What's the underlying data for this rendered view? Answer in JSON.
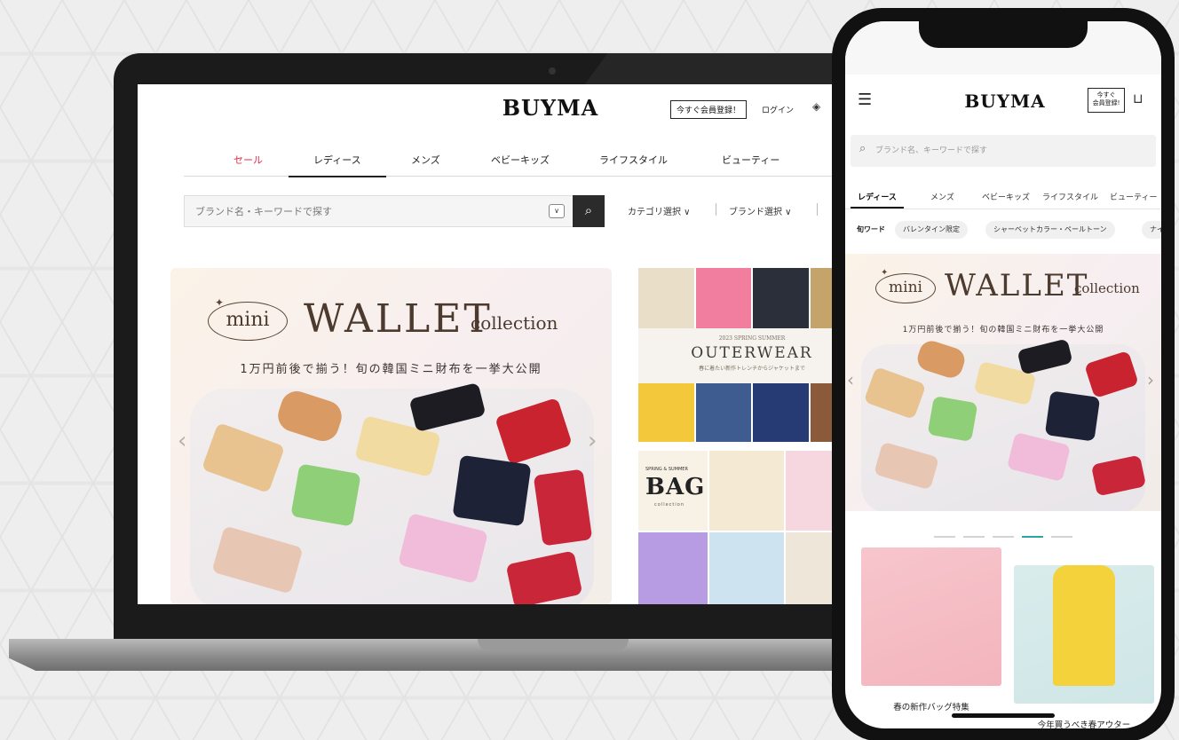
{
  "desktop": {
    "logo": "BUYMA",
    "register_label": "今すぐ会員登録！",
    "login_label": "ログイン",
    "nav": [
      {
        "label": "セール"
      },
      {
        "label": "レディース"
      },
      {
        "label": "メンズ"
      },
      {
        "label": "ベビーキッズ"
      },
      {
        "label": "ライフスタイル"
      },
      {
        "label": "ビューティー"
      }
    ],
    "search_placeholder": "ブランド名・キーワードで探す",
    "filters": [
      {
        "label": "カテゴリ選択"
      },
      {
        "label": "ブランド選択"
      }
    ],
    "hero": {
      "pill": "mini",
      "title": "WALLET",
      "subtitle": "collection",
      "caption": "1万円前後で揃う！旬の韓国ミニ財布を一挙大公開"
    },
    "side_banners": {
      "outerwear_year": "2023 SPRING SUMMER",
      "outerwear_title": "OUTERWEAR",
      "outerwear_sub": "春に着たい新作トレンチからジャケットまで",
      "bag_season": "SPRING & SUMMER",
      "bag_title": "BAG",
      "bag_sub": "collection"
    }
  },
  "mobile": {
    "logo": "BUYMA",
    "register_label_line1": "今すぐ",
    "register_label_line2": "会員登録!",
    "search_placeholder": "ブランド名、キーワードで探す",
    "tabs": [
      {
        "label": "レディース"
      },
      {
        "label": "メンズ"
      },
      {
        "label": "ベビーキッズ"
      },
      {
        "label": "ライフスタイル"
      },
      {
        "label": "ビューティー"
      }
    ],
    "chip_label": "旬ワード",
    "chips": [
      {
        "label": "バレンタイン限定"
      },
      {
        "label": "シャーベットカラー・ペールトーン"
      },
      {
        "label": "ナイ"
      }
    ],
    "hero": {
      "pill": "mini",
      "title": "WALLET",
      "subtitle": "collection",
      "caption": "1万円前後で揃う！旬の韓国ミニ財布を一挙大公開"
    },
    "carousel": {
      "count": 5,
      "active_index": 3
    },
    "cards": [
      {
        "caption": "春の新作バッグ特集"
      },
      {
        "caption": "今年買うべき春アウター"
      }
    ]
  },
  "icons": {
    "search": "magnifier-icon",
    "menu": "hamburger-menu-icon",
    "cart": "cart-icon",
    "tag": "tag-icon",
    "chevron": "chevron-down-icon"
  },
  "colors": {
    "sale_red": "#d8314b",
    "carousel_active": "#2aa6a0",
    "wallet_brown": "#4b3a2d"
  }
}
